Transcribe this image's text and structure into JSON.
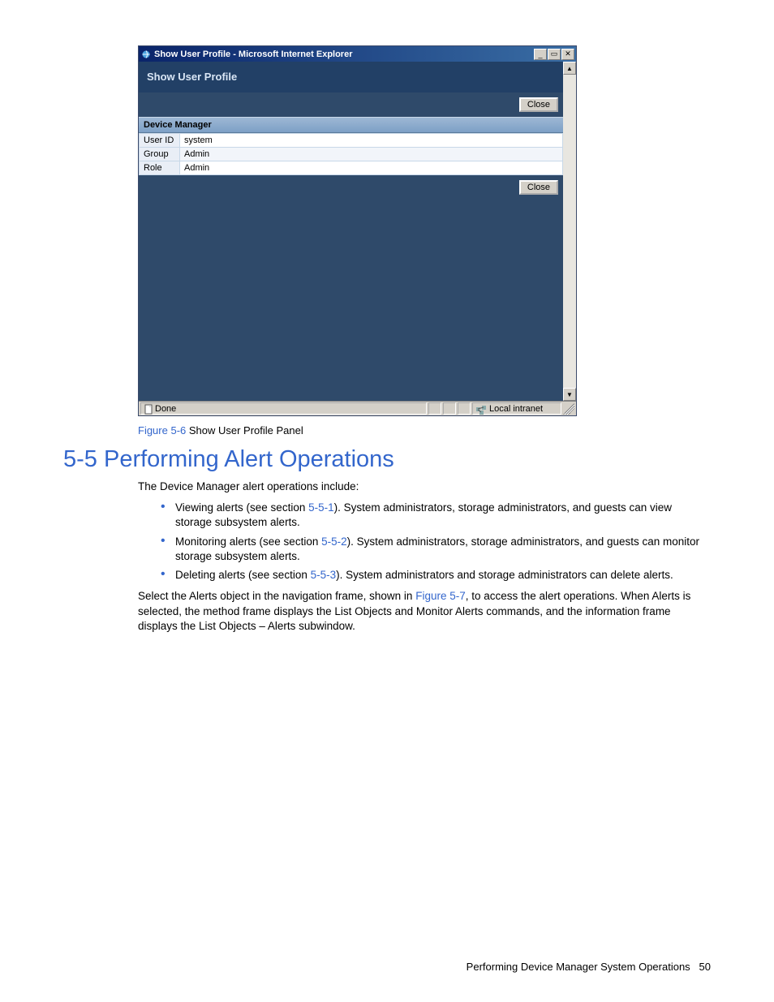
{
  "ie": {
    "title": "Show User Profile - Microsoft Internet Explorer",
    "status_left": "Done",
    "status_zone": "Local intranet"
  },
  "profile": {
    "header": "Show User Profile",
    "close": "Close",
    "section": "Device Manager",
    "rows": [
      {
        "label": "User ID",
        "value": "system"
      },
      {
        "label": "Group",
        "value": "Admin"
      },
      {
        "label": "Role",
        "value": "Admin"
      }
    ]
  },
  "caption": {
    "link": "Figure 5-6",
    "rest": " Show User Profile Panel"
  },
  "heading": "5-5 Performing Alert Operations",
  "intro": "The Device Manager alert operations include:",
  "bullets": [
    {
      "pre": "Viewing alerts (see section ",
      "link": "5-5-1",
      "post": "). System administrators, storage administrators, and guests can view storage subsystem alerts."
    },
    {
      "pre": "Monitoring alerts (see section ",
      "link": "5-5-2",
      "post": "). System administrators, storage administrators, and guests can monitor storage subsystem alerts."
    },
    {
      "pre": "Deleting alerts (see section ",
      "link": "5-5-3",
      "post": "). System administrators and storage administrators can delete alerts."
    }
  ],
  "para2": {
    "pre": "Select the Alerts object in the navigation frame, shown in ",
    "link": "Figure 5-7",
    "post": ", to access the alert operations. When Alerts is selected, the method frame displays the List Objects and Monitor Alerts commands, and the information frame displays the List Objects – Alerts subwindow."
  },
  "footer": {
    "text": "Performing Device Manager System Operations",
    "page": "50"
  }
}
